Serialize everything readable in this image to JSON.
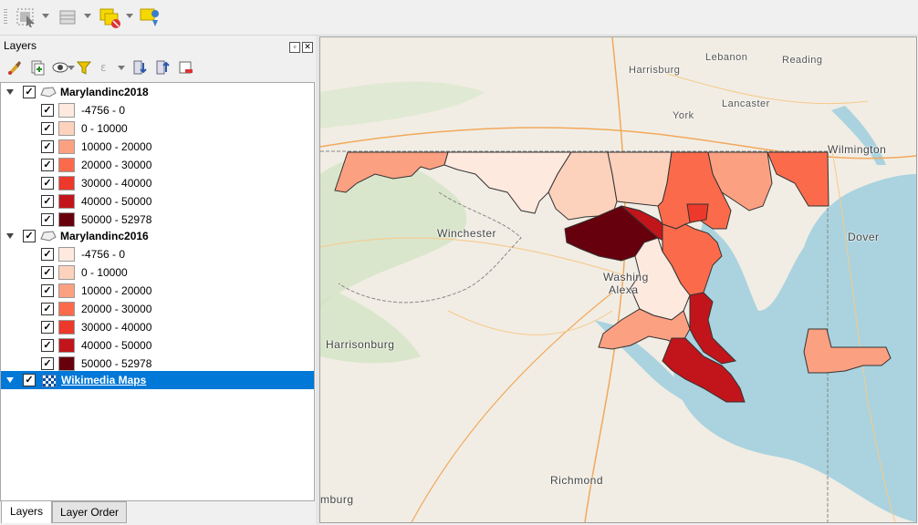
{
  "toolbar": {
    "icons": [
      "select-features-icon",
      "attribute-table-icon",
      "deselect-icon",
      "add-annotation-icon"
    ]
  },
  "panel": {
    "title": "Layers"
  },
  "layers": [
    {
      "name": "Marylandinc2018",
      "checked": true,
      "expanded": true,
      "classes": [
        {
          "label": "-4756 - 0",
          "color": "#fee9df"
        },
        {
          "label": "0 - 10000",
          "color": "#fdd2bd"
        },
        {
          "label": "10000 - 20000",
          "color": "#fca082"
        },
        {
          "label": "20000 - 30000",
          "color": "#fb6b4b"
        },
        {
          "label": "30000 - 40000",
          "color": "#ed392b"
        },
        {
          "label": "40000 - 50000",
          "color": "#c1151b"
        },
        {
          "label": "50000 - 52978",
          "color": "#67000d"
        }
      ]
    },
    {
      "name": "Marylandinc2016",
      "checked": true,
      "expanded": true,
      "classes": [
        {
          "label": "-4756 - 0",
          "color": "#fee9df"
        },
        {
          "label": "0 - 10000",
          "color": "#fdd2bd"
        },
        {
          "label": "10000 - 20000",
          "color": "#fca082"
        },
        {
          "label": "20000 - 30000",
          "color": "#fb6b4b"
        },
        {
          "label": "30000 - 40000",
          "color": "#ed392b"
        },
        {
          "label": "40000 - 50000",
          "color": "#c1151b"
        },
        {
          "label": "50000 - 52978",
          "color": "#67000d"
        }
      ]
    },
    {
      "name": "Wikimedia Maps",
      "checked": true,
      "selected": true
    }
  ],
  "tabs": [
    {
      "label": "Layers",
      "active": true
    },
    {
      "label": "Layer Order",
      "active": false
    }
  ],
  "map": {
    "places": [
      "Harrisburg",
      "Lebanon",
      "Reading",
      "York",
      "Lancaster",
      "Wilmington",
      "Winchester",
      "Washing",
      "Alexa",
      "Dover",
      "Harrisonburg",
      "Richmond",
      "mburg"
    ]
  },
  "colors": {
    "selection": "#0078d7",
    "water": "#aad3df",
    "land": "#f1ede4"
  }
}
